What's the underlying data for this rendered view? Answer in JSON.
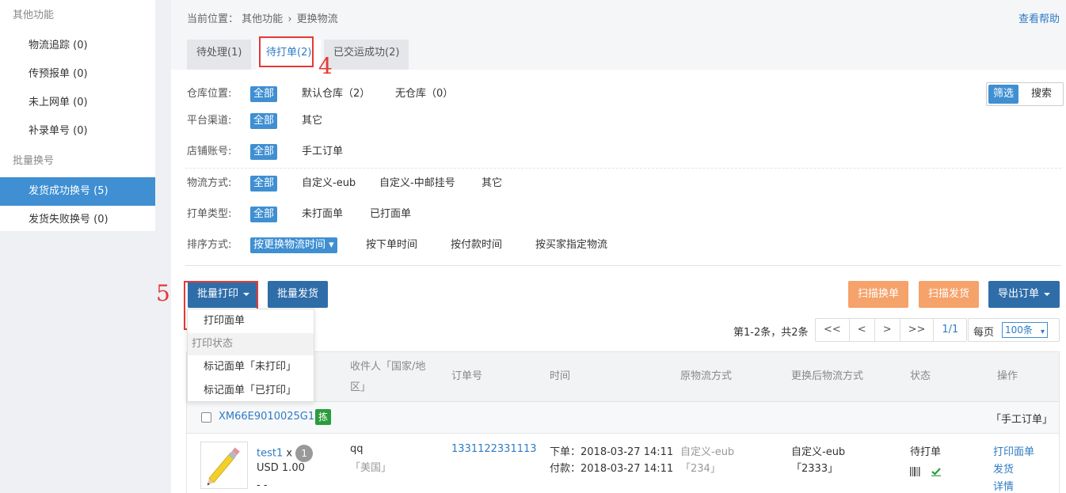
{
  "sidebar": {
    "group1": "其他功能",
    "items1": [
      {
        "label": "物流追踪 (0)"
      },
      {
        "label": "传预报单 (0)"
      },
      {
        "label": "未上网单 (0)"
      },
      {
        "label": "补录单号 (0)"
      }
    ],
    "group2": "批量换号",
    "items2": [
      {
        "label": "发货成功换号 (5)"
      },
      {
        "label": "发货失败换号 (0)"
      }
    ]
  },
  "header": {
    "crumb_prefix": "当前位置：",
    "crumb_1": "其他功能",
    "crumb_sep": "›",
    "crumb_2": "更换物流",
    "help": "查看帮助"
  },
  "tabs": [
    {
      "label": "待处理(1)"
    },
    {
      "label": "待打单(2)"
    },
    {
      "label": "已交运成功(2)"
    }
  ],
  "annotations": {
    "step4": "4",
    "step5": "5"
  },
  "toggle": {
    "filter": "筛选",
    "search": "搜索"
  },
  "filters": {
    "warehouse": {
      "label": "仓库位置:",
      "options": [
        "全部",
        "默认仓库（2）",
        "无仓库（0）"
      ]
    },
    "channel": {
      "label": "平台渠道:",
      "options": [
        "全部",
        "其它"
      ]
    },
    "shop": {
      "label": "店铺账号:",
      "options": [
        "全部",
        "手工订单"
      ]
    },
    "logistics": {
      "label": "物流方式:",
      "options": [
        "全部",
        "自定义-eub",
        "自定义-中邮挂号",
        "其它"
      ]
    },
    "print_type": {
      "label": "打单类型:",
      "options": [
        "全部",
        "未打面单",
        "已打面单"
      ]
    },
    "sort": {
      "label": "排序方式:",
      "options": [
        "按更换物流时间 ▾",
        "按下单时间",
        "按付款时间",
        "按买家指定物流"
      ]
    }
  },
  "toolbar": {
    "batch_print": "批量打印",
    "batch_ship": "批量发货",
    "scan_swap": "扫描换单",
    "scan_ship": "扫描发货",
    "export": "导出订单"
  },
  "dropdown": {
    "print_label": "打印面单",
    "section": "打印状态",
    "mark_unprinted": "标记面单「未打印」",
    "mark_printed": "标记面单「已打印」"
  },
  "pagination": {
    "info": "第1-2条，共2条",
    "first": "<<",
    "prev": "<",
    "next": ">",
    "last": ">>",
    "page": "1/1",
    "per_page_label": "每页",
    "per_page_value": "100条"
  },
  "table": {
    "headers": {
      "recipient_1": "收件人「国家/地",
      "recipient_2": "区」",
      "order_no": "订单号",
      "time": "时间",
      "orig_logistics": "原物流方式",
      "new_logistics": "更换后物流方式",
      "status": "状态",
      "actions": "操作"
    },
    "order": {
      "id": "XM66E9010025G1",
      "pick_badge": "拣",
      "source": "「手工订单」",
      "item_name": "test1",
      "qty_x": "x",
      "qty": "1",
      "price": "USD 1.00",
      "more": "- -",
      "recipient": "qq",
      "country": "「美国」",
      "order_no": "1331122331113",
      "order_time": "下单：2018-03-27 14:11",
      "pay_time": "付款：2018-03-27 14:11",
      "orig_logistics": "自定义-eub",
      "orig_tracking": "「234」",
      "new_logistics": "自定义-eub",
      "new_tracking": "「2333」",
      "status": "待打单",
      "action_print": "打印面单",
      "action_ship": "发货",
      "action_detail": "详情"
    }
  },
  "colors": {
    "accent": "#3f8fd2",
    "button_dark": "#2f6da9",
    "button_orange": "#f5a26b",
    "annotation_red": "#e53935",
    "badge_green": "#2a9c3b"
  }
}
